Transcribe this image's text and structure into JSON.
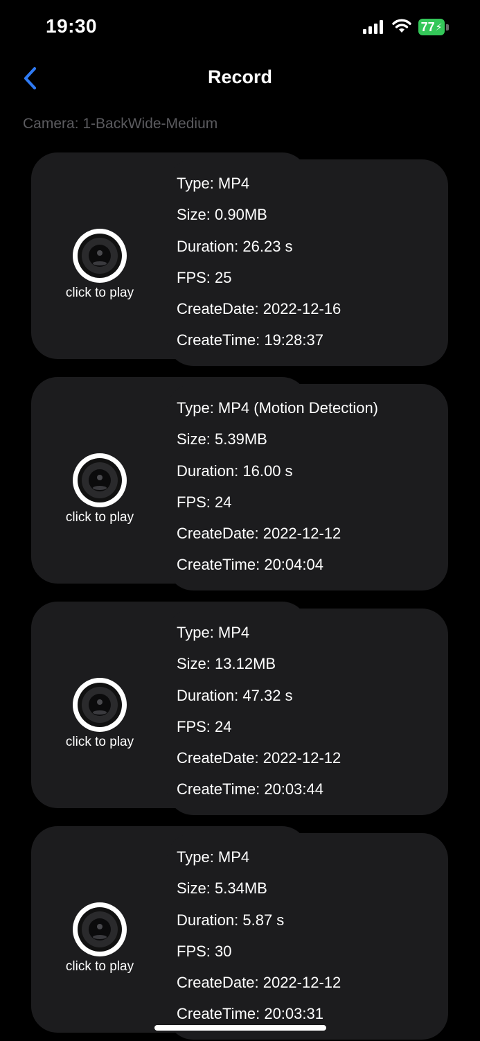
{
  "status_bar": {
    "time": "19:30",
    "battery_level": "77",
    "signal_icon": "cellular-signal-icon",
    "wifi_icon": "wifi-icon",
    "battery_color": "#34c759"
  },
  "nav": {
    "title": "Record",
    "back_icon": "chevron-left-icon",
    "accent_color": "#2f7bf5"
  },
  "camera_label": "Camera: 1-BackWide-Medium",
  "records": [
    {
      "play_label": "click to play",
      "type": "Type: MP4",
      "size": "Size: 0.90MB",
      "duration": "Duration: 26.23 s",
      "fps": "FPS: 25",
      "create_date": "CreateDate: 2022-12-16",
      "create_time": "CreateTime: 19:28:37"
    },
    {
      "play_label": "click to play",
      "type": "Type: MP4 (Motion Detection)",
      "size": "Size: 5.39MB",
      "duration": "Duration: 16.00 s",
      "fps": "FPS: 24",
      "create_date": "CreateDate: 2022-12-12",
      "create_time": "CreateTime: 20:04:04"
    },
    {
      "play_label": "click to play",
      "type": "Type: MP4",
      "size": "Size: 13.12MB",
      "duration": "Duration: 47.32 s",
      "fps": "FPS: 24",
      "create_date": "CreateDate: 2022-12-12",
      "create_time": "CreateTime: 20:03:44"
    },
    {
      "play_label": "click to play",
      "type": "Type: MP4",
      "size": "Size: 5.34MB",
      "duration": "Duration: 5.87 s",
      "fps": "FPS: 30",
      "create_date": "CreateDate: 2022-12-12",
      "create_time": "CreateTime: 20:03:31"
    }
  ]
}
